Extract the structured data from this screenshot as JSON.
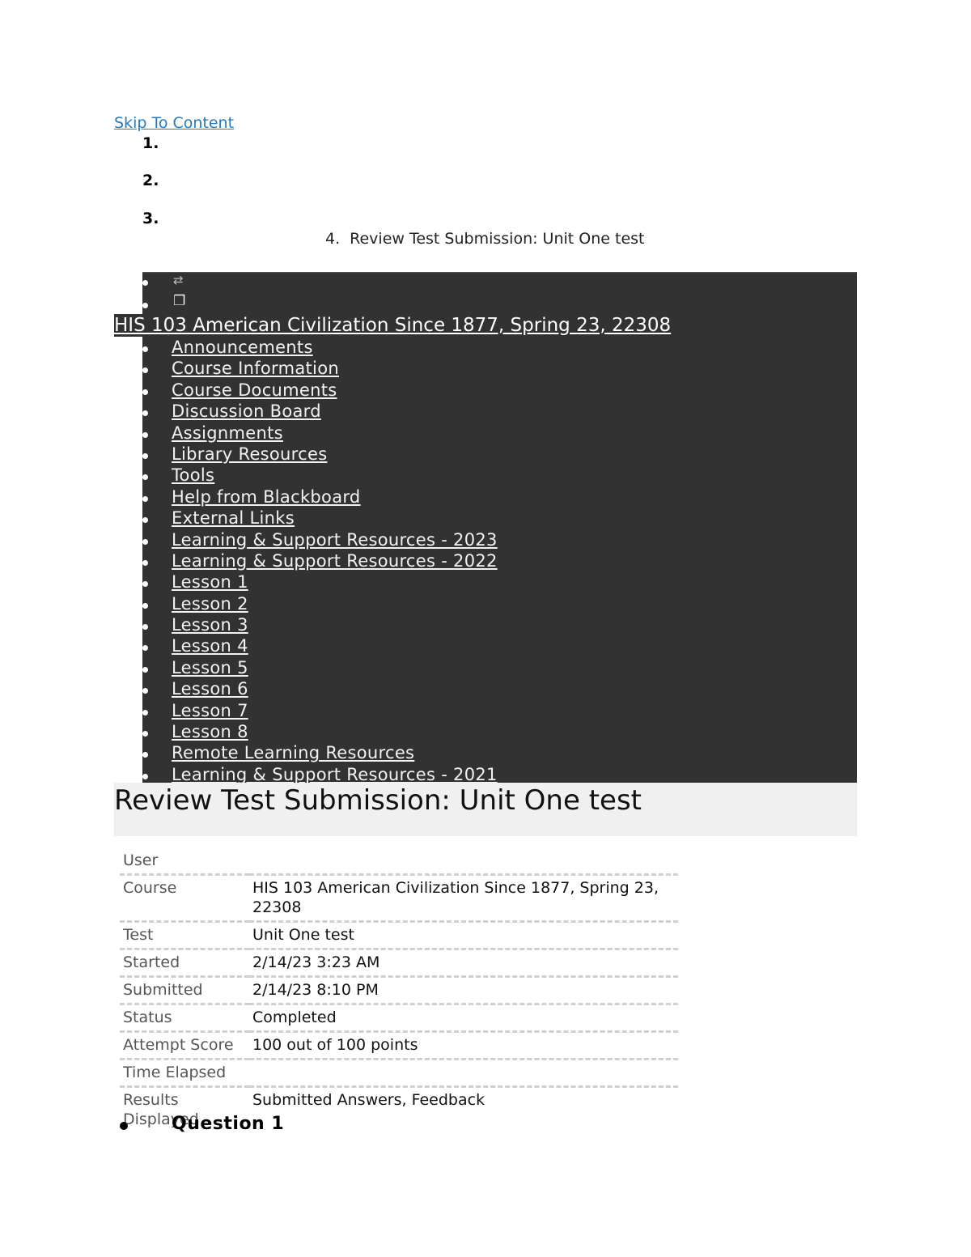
{
  "skip_link": "Skip To Content",
  "breadcrumb": {
    "items": [
      {
        "number": "1.",
        "label": ""
      },
      {
        "number": "2.",
        "label": ""
      },
      {
        "number": "3.",
        "label": ""
      },
      {
        "number": "4.",
        "label": "Review Test Submission: Unit One test"
      }
    ]
  },
  "course_menu": {
    "icons": [
      {
        "name": "refresh-icon",
        "glyph": "⇄"
      },
      {
        "name": "windows-icon",
        "glyph": "❐"
      }
    ],
    "course_title": "HIS 103 American Civilization Since 1877, Spring 23, 22308",
    "items": [
      "Announcements",
      "Course Information",
      "Course Documents",
      "Discussion Board",
      "Assignments",
      "Library Resources",
      "Tools",
      "Help from Blackboard",
      "External Links",
      "Learning & Support Resources - 2023",
      "Learning & Support Resources - 2022",
      "Lesson 1",
      "Lesson 2",
      "Lesson 3",
      "Lesson 4",
      "Lesson 5",
      "Lesson 6",
      "Lesson 7",
      "Lesson 8",
      "Remote Learning Resources",
      "Learning & Support Resources - 2021"
    ]
  },
  "page": {
    "title": "Review Test Submission: Unit One test"
  },
  "details": [
    {
      "label": "User",
      "value": ""
    },
    {
      "label": "Course",
      "value": "HIS 103 American Civilization Since 1877, Spring 23, 22308"
    },
    {
      "label": "Test",
      "value": "Unit One test"
    },
    {
      "label": "Started",
      "value": "2/14/23 3:23 AM"
    },
    {
      "label": "Submitted",
      "value": "2/14/23 8:10 PM"
    },
    {
      "label": "Status",
      "value": "Completed"
    },
    {
      "label": "Attempt Score",
      "value": "100 out of 100 points"
    },
    {
      "label": "Time Elapsed",
      "value": ""
    },
    {
      "label": "Results Displayed",
      "value": "Submitted Answers, Feedback"
    }
  ],
  "questions": [
    {
      "label": "Question 1"
    }
  ]
}
